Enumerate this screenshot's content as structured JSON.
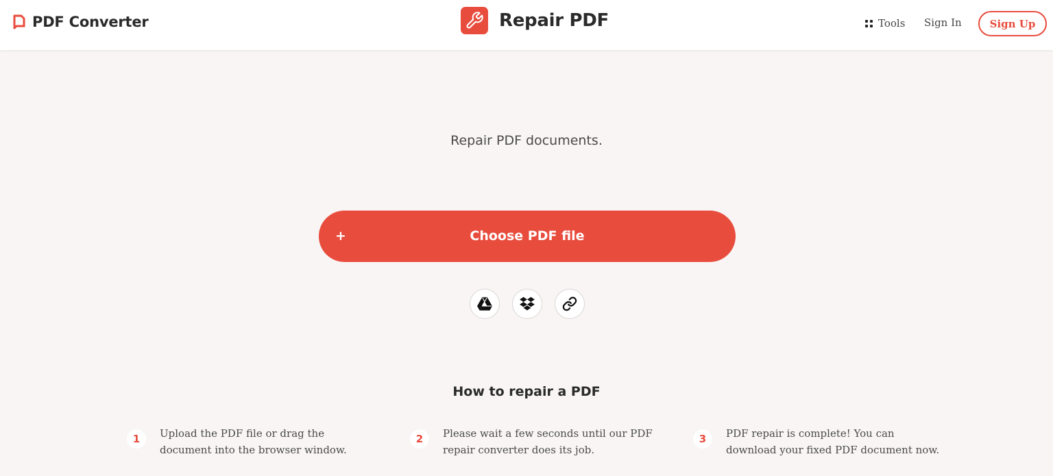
{
  "header": {
    "brand_name": "PDF Converter",
    "tool_name": "Repair PDF",
    "nav_tools_label": "Tools",
    "sign_in_label": "Sign In",
    "sign_up_label": "Sign Up",
    "icons": {
      "brand": "pdf-converter-logo-icon",
      "tool": "wrench-icon",
      "tools": "grid-icon"
    }
  },
  "main": {
    "subtitle": "Repair PDF documents.",
    "choose_button": {
      "plus": "+",
      "label": "Choose PDF file"
    },
    "sources": [
      {
        "name": "google-drive",
        "icon": "google-drive-icon"
      },
      {
        "name": "dropbox",
        "icon": "dropbox-icon"
      },
      {
        "name": "url-link",
        "icon": "link-icon"
      }
    ]
  },
  "howto": {
    "title": "How to repair a PDF",
    "steps": [
      {
        "number": "1",
        "text": "Upload the PDF file or drag the document into the browser window."
      },
      {
        "number": "2",
        "text": "Please wait a few seconds until our PDF repair converter does its job."
      },
      {
        "number": "3",
        "text": "PDF repair is complete! You can download your fixed PDF document now."
      }
    ]
  },
  "colors": {
    "accent": "#e84c3d",
    "background": "#f8f5f4",
    "header": "#ffffff"
  }
}
